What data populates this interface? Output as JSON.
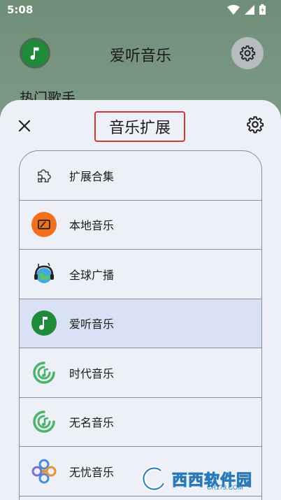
{
  "status_bar": {
    "time": "5:08"
  },
  "app": {
    "title": "爱听音乐",
    "section_heading": "热门歌手"
  },
  "sheet": {
    "title": "音乐扩展",
    "items": [
      {
        "label": "扩展合集",
        "icon": "puzzle-icon"
      },
      {
        "label": "本地音乐",
        "icon": "local-music-icon"
      },
      {
        "label": "全球广播",
        "icon": "globe-headphones-icon"
      },
      {
        "label": "爱听音乐",
        "icon": "music-note-icon",
        "selected": true
      },
      {
        "label": "时代音乐",
        "icon": "swirl-music-icon"
      },
      {
        "label": "无名音乐",
        "icon": "swirl-music-icon"
      },
      {
        "label": "无忧音乐",
        "icon": "knot-icon"
      }
    ]
  },
  "watermark": {
    "text": "西西软件园",
    "sub": "CR173.COM"
  },
  "colors": {
    "accent_green": "#1e8a3a",
    "highlight_red": "#d13a2e",
    "selected_bg": "#d9e2f5",
    "orange": "#f36f1d"
  }
}
